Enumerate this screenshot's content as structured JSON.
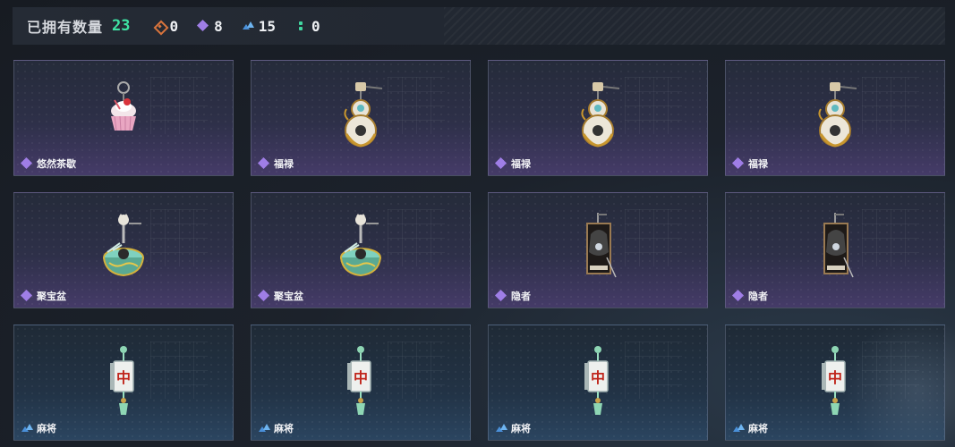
{
  "header": {
    "owned_label": "已拥有数量",
    "owned_count": "23",
    "stats": [
      {
        "icon": "orange-diamond-icon",
        "value": "0",
        "color": "#d9743c"
      },
      {
        "icon": "purple-diamond-cluster-icon",
        "value": "8",
        "color": "#9f7ee6"
      },
      {
        "icon": "blue-peaks-icon",
        "value": "15",
        "color": "#4a90d9"
      },
      {
        "icon": "green-dots-icon",
        "value": "0",
        "color": "#41d6a0"
      }
    ]
  },
  "items": [
    {
      "name": "悠然茶歇",
      "rarity": "purple",
      "art": "cupcake"
    },
    {
      "name": "福禄",
      "rarity": "purple",
      "art": "gourd"
    },
    {
      "name": "福禄",
      "rarity": "purple",
      "art": "gourd"
    },
    {
      "name": "福禄",
      "rarity": "purple",
      "art": "gourd"
    },
    {
      "name": "聚宝盆",
      "rarity": "purple",
      "art": "bowl"
    },
    {
      "name": "聚宝盆",
      "rarity": "purple",
      "art": "bowl"
    },
    {
      "name": "隐者",
      "rarity": "purple",
      "art": "card"
    },
    {
      "name": "隐者",
      "rarity": "purple",
      "art": "card"
    },
    {
      "name": "麻将",
      "rarity": "blue",
      "art": "mahjong"
    },
    {
      "name": "麻将",
      "rarity": "blue",
      "art": "mahjong"
    },
    {
      "name": "麻将",
      "rarity": "blue",
      "art": "mahjong"
    },
    {
      "name": "麻将",
      "rarity": "blue",
      "art": "mahjong"
    }
  ],
  "colors": {
    "accent_green": "#3fe3a4",
    "rarity_purple": "#9f7ee6",
    "rarity_blue": "#4a90d9"
  }
}
